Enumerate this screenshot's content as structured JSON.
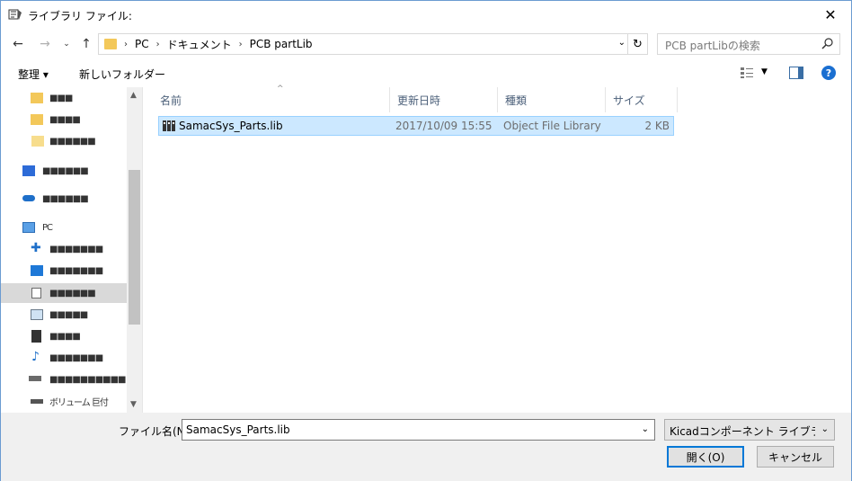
{
  "window": {
    "title": "ライブラリ ファイル:"
  },
  "address": {
    "segments": [
      "PC",
      "ドキュメント",
      "PCB partLib"
    ],
    "search_placeholder": "PCB partLibの検索"
  },
  "toolbar": {
    "organize_label": "整理 ▾",
    "new_folder_label": "新しいフォルダー"
  },
  "nav": {
    "items": [
      {
        "label": "■■■",
        "icon": "pinned-folder-icon"
      },
      {
        "label": "■■■■",
        "icon": "pinned-folder-icon"
      },
      {
        "label": "■■■■■■",
        "icon": "folder-icon"
      },
      {
        "label": "■■■■■■",
        "icon": "dropbox-icon"
      },
      {
        "label": "■■■■■■",
        "icon": "onedrive-icon"
      },
      {
        "label": "PC",
        "icon": "pc-icon"
      },
      {
        "label": "■■■■■■■",
        "icon": "3d-objects-icon"
      },
      {
        "label": "■■■■■■■",
        "icon": "desktop-icon"
      },
      {
        "label": "■■■■■■",
        "icon": "documents-icon"
      },
      {
        "label": "■■■■■",
        "icon": "pictures-icon"
      },
      {
        "label": "■■■■",
        "icon": "videos-icon"
      },
      {
        "label": "■■■■■■■",
        "icon": "music-icon"
      },
      {
        "label": "■■■■■■■■■■",
        "icon": "local-disk-icon"
      },
      {
        "label": "ボリューム 巨付",
        "icon": "drive-icon"
      }
    ]
  },
  "columns": {
    "name": "名前",
    "date": "更新日時",
    "type": "種類",
    "size": "サイズ"
  },
  "files": [
    {
      "name": "SamacSys_Parts.lib",
      "date": "2017/10/09 15:55",
      "type": "Object File Library",
      "size": "2 KB"
    }
  ],
  "bottom": {
    "filename_label": "ファイル名(N):",
    "filename_value": "SamacSys_Parts.lib",
    "filter_value": "Kicadコンポーネント ライブラリ ファイ",
    "open_label": "開く(O)",
    "cancel_label": "キャンセル"
  }
}
